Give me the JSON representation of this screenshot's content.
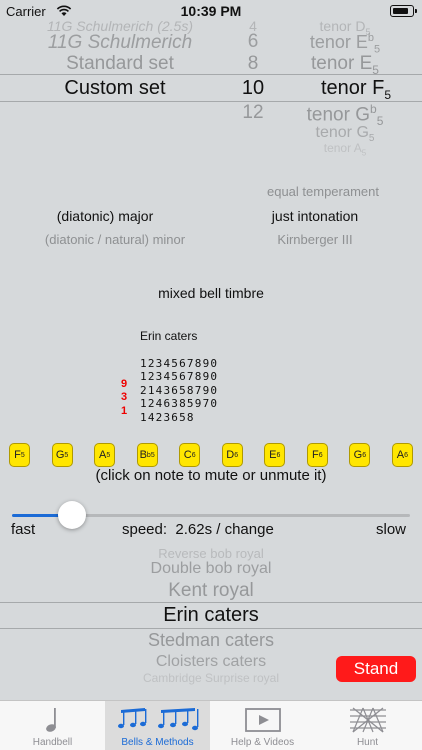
{
  "status": {
    "carrier": "Carrier",
    "time": "10:39 PM"
  },
  "bell_set_picker": {
    "items": [
      "11G Schulmerich (2.5s)",
      "11G Schulmerich",
      "Standard set",
      "Custom set"
    ],
    "selected": "Custom set"
  },
  "bells_picker": {
    "items": [
      "4",
      "6",
      "8",
      "10",
      "12"
    ],
    "selected": "10"
  },
  "tenor_picker": {
    "items": [
      {
        "note": "tenor D",
        "acc": "",
        "oct": "5"
      },
      {
        "note": "tenor E",
        "acc": "b",
        "oct": "5"
      },
      {
        "note": "tenor E",
        "acc": "",
        "oct": "5"
      },
      {
        "note": "tenor F",
        "acc": "",
        "oct": "5"
      },
      {
        "note": "tenor G",
        "acc": "b",
        "oct": "5"
      },
      {
        "note": "tenor G",
        "acc": "",
        "oct": "5"
      },
      {
        "note": "tenor A",
        "acc": "",
        "oct": "5"
      }
    ],
    "selected": "tenor F"
  },
  "scale": {
    "major": "(diatonic) major",
    "minor": "(diatonic / natural) minor"
  },
  "tuning": {
    "equal": "equal temperament",
    "just": "just intonation",
    "kirnberger": "Kirnberger III"
  },
  "timbre": "mixed bell timbre",
  "method_display": {
    "title": "Erin caters",
    "rows": [
      "1234567890",
      "1234567890",
      "2143658790",
      "1246385970",
      "1423658"
    ],
    "calls": [
      "9",
      "3",
      "1"
    ]
  },
  "notes": [
    {
      "letter": "F",
      "acc": "",
      "oct": "5"
    },
    {
      "letter": "G",
      "acc": "",
      "oct": "5"
    },
    {
      "letter": "A",
      "acc": "",
      "oct": "5"
    },
    {
      "letter": "B",
      "acc": "b",
      "oct": "5"
    },
    {
      "letter": "C",
      "acc": "",
      "oct": "6"
    },
    {
      "letter": "D",
      "acc": "",
      "oct": "6"
    },
    {
      "letter": "E",
      "acc": "",
      "oct": "6"
    },
    {
      "letter": "F",
      "acc": "",
      "oct": "6"
    },
    {
      "letter": "G",
      "acc": "",
      "oct": "6"
    },
    {
      "letter": "A",
      "acc": "",
      "oct": "6"
    }
  ],
  "mute_hint": "(click on note to mute or unmute it)",
  "speed": {
    "fast": "fast",
    "label": "speed:  2.62s / change",
    "slow": "slow",
    "position": 0.15
  },
  "method_picker": {
    "items": [
      "Reverse bob royal",
      "Double bob royal",
      "Kent royal",
      "Erin caters",
      "Stedman caters",
      "Cloisters caters",
      "Cambridge Surprise royal"
    ],
    "selected": "Erin caters"
  },
  "stand_label": "Stand",
  "tabs": [
    {
      "label": "Handbell",
      "icon": "handbell-note-icon",
      "active": false
    },
    {
      "label": "Bells & Methods",
      "icon": "music-notes-icon",
      "active": true
    },
    {
      "label": "Help & Videos",
      "icon": "video-play-icon",
      "active": false
    },
    {
      "label": "Hunt",
      "icon": "hunt-grid-icon",
      "active": false
    }
  ],
  "colors": {
    "accent": "#1b6bd6",
    "note_button": "#ffe600",
    "stand": "#ff1a1a",
    "calls": "#e00000"
  }
}
